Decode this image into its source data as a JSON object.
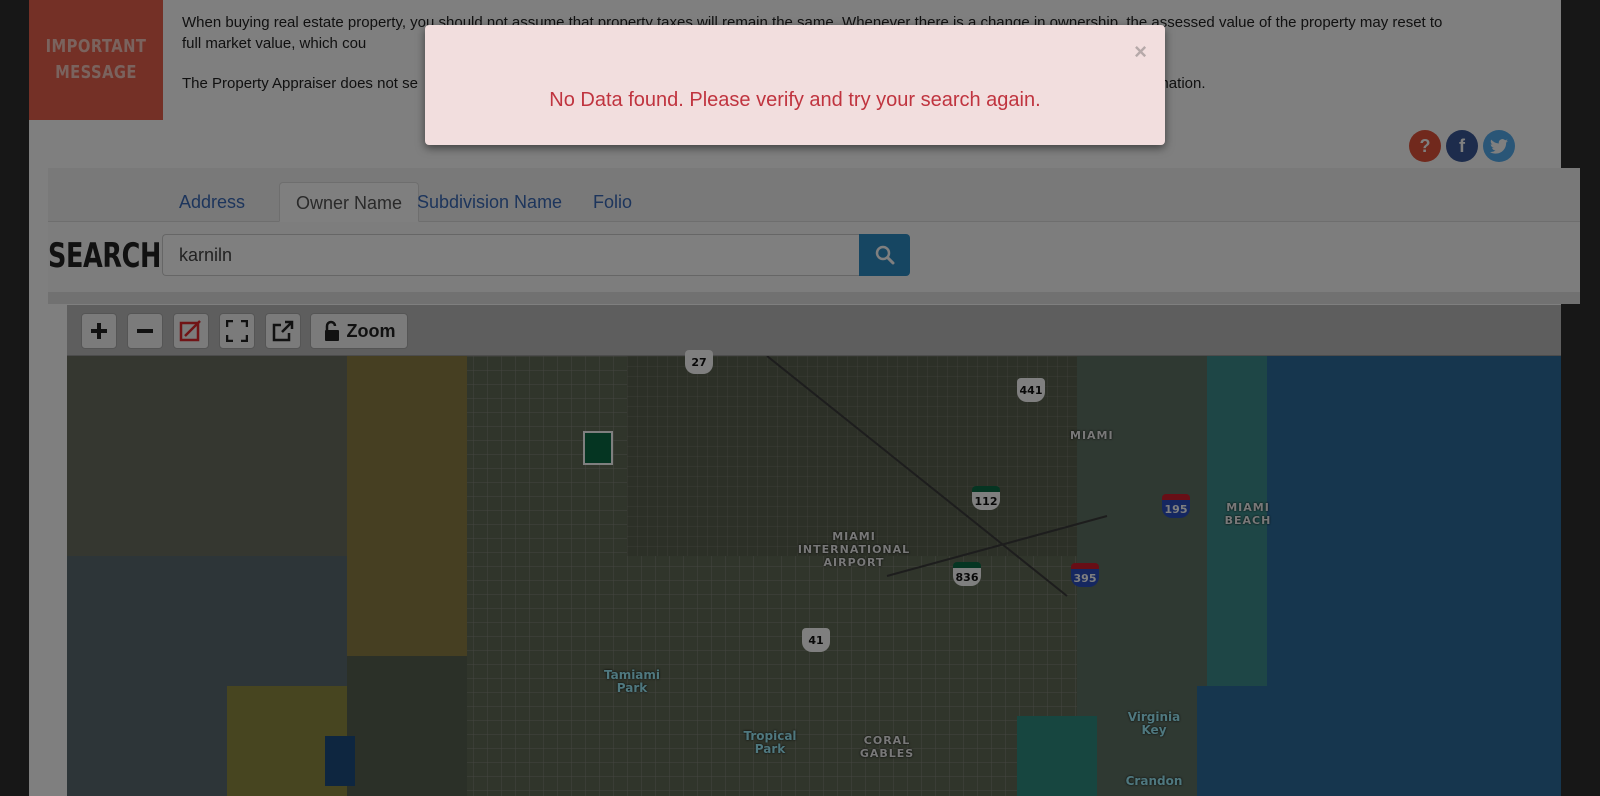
{
  "notice": {
    "box_label": "IMPORTANT MESSAGE",
    "paragraph1": "When buying real estate property, you should not assume that property taxes will remain the same. Whenever there is a change in ownership, the assessed value of the property may reset to full market value, which cou",
    "paragraph2": "The Property Appraiser does not se",
    "paragraph2_tail": "rmation."
  },
  "social": {
    "help_icon": "question-mark",
    "facebook_icon": "f",
    "twitter_icon": "bird"
  },
  "tabs": [
    {
      "label": "Address"
    },
    {
      "label": "Owner Name"
    },
    {
      "label": "Subdivision Name"
    },
    {
      "label": "Folio"
    }
  ],
  "search": {
    "label": "SEARCH:",
    "value": "karniln"
  },
  "map": {
    "zoom_label": "Zoom",
    "labels": {
      "miami": "MIAMI",
      "airport": "MIAMI INTERNATIONAL AIRPORT",
      "miami_beach": "MIAMI BEACH",
      "coral_gables": "CORAL GABLES",
      "tamiami_park": "Tamiami Park",
      "tropical_park": "Tropical Park",
      "virginia_key": "Virginia Key",
      "crandon": "Crandon"
    },
    "shields": {
      "s27": "27",
      "s441": "441",
      "s112": "112",
      "s195": "195",
      "s836": "836",
      "s395": "395",
      "s41": "41"
    }
  },
  "modal": {
    "close_glyph": "×",
    "message": "No Data found. Please verify and try your search again."
  }
}
